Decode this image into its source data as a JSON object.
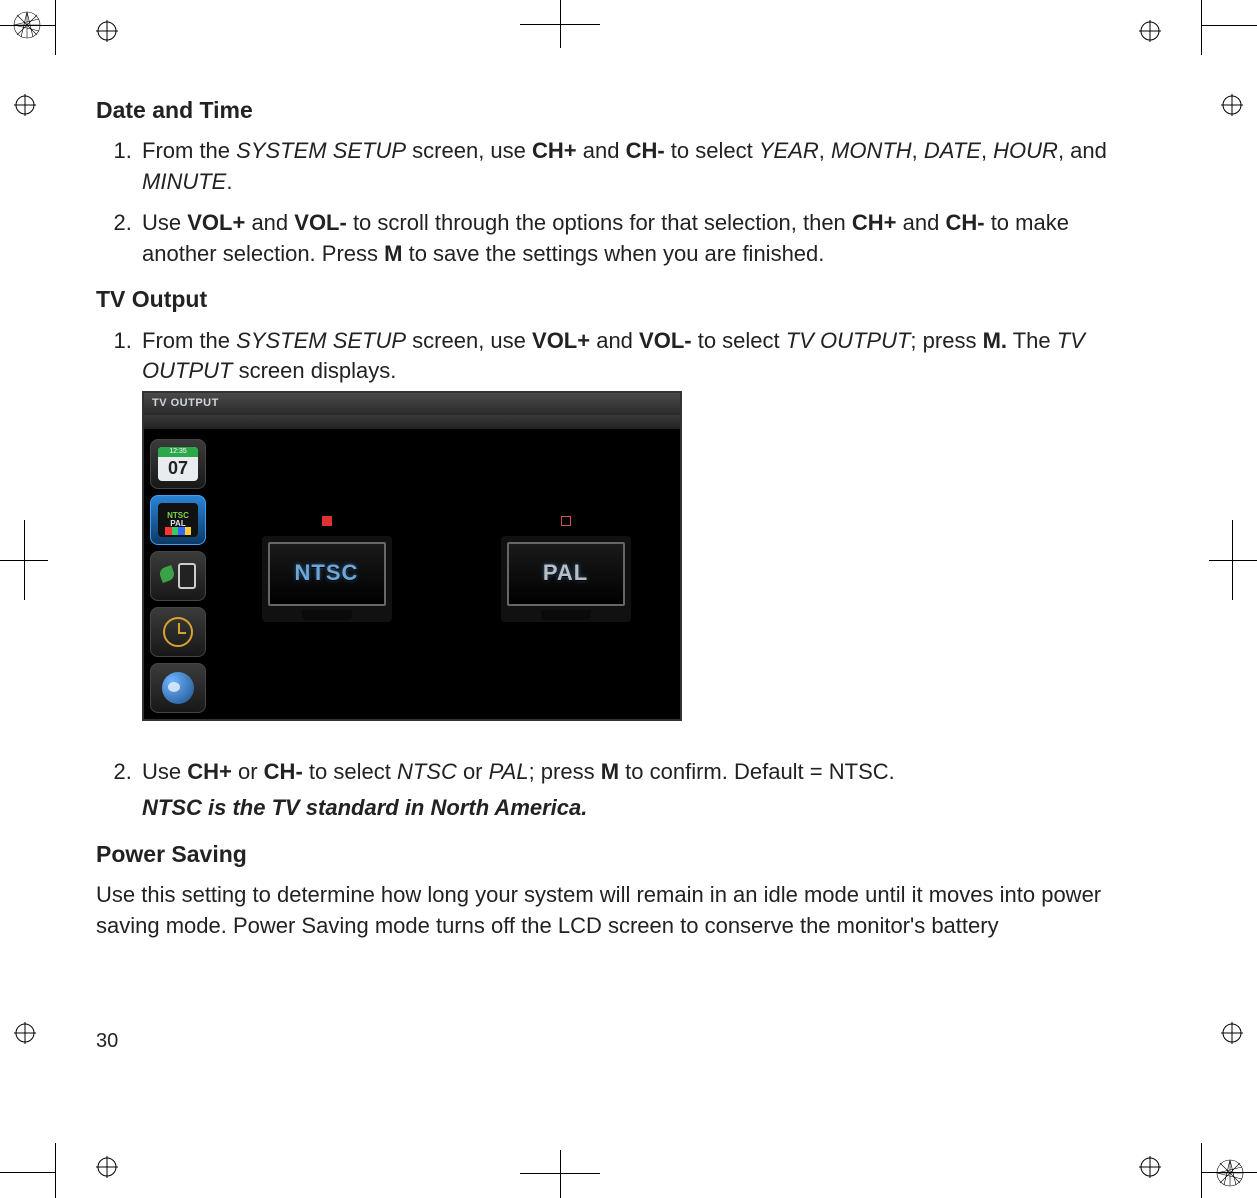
{
  "page_number": "30",
  "sections": {
    "date_time": {
      "heading": "Date and Time",
      "step1_parts": [
        "From the ",
        "SYSTEM SETUP",
        " screen, use ",
        "CH+",
        " and ",
        "CH-",
        " to select ",
        "YEAR",
        ", ",
        "MONTH",
        ", ",
        "DATE",
        ", ",
        "HOUR",
        ", and ",
        "MINUTE",
        "."
      ],
      "step2_parts": [
        "Use ",
        "VOL+",
        " and ",
        "VOL-",
        " to scroll through the options for that selection, then ",
        "CH+",
        " and ",
        "CH-",
        " to make another selection. Press ",
        "M",
        " to save the settings when you are finished."
      ]
    },
    "tv_output": {
      "heading": "TV Output",
      "step1_parts": [
        "From the ",
        "SYSTEM SETUP",
        " screen, use ",
        "VOL+",
        " and ",
        "VOL-",
        " to select ",
        "TV OUTPUT",
        "; press ",
        "M.",
        " The ",
        "TV OUTPUT",
        " screen displays."
      ],
      "figure": {
        "titlebar": "TV OUTPUT",
        "calendar_time": "12:35",
        "calendar_day": "07",
        "ntscpal_chip": {
          "top": "NTSC",
          "bottom": "PAL"
        },
        "option_a": "NTSC",
        "option_b": "PAL"
      },
      "step2_parts": [
        "Use ",
        "CH+",
        " or ",
        "CH-",
        " to select ",
        "NTSC",
        " or ",
        "PAL",
        "; press ",
        "M",
        " to confirm. Default = NTSC."
      ],
      "note": "NTSC is the TV standard in North America."
    },
    "power_saving": {
      "heading": "Power Saving",
      "para": "Use this setting to determine how long your system will remain in an idle mode until it moves into power saving mode. Power Saving mode turns off the LCD screen to conserve the monitor's battery"
    }
  }
}
